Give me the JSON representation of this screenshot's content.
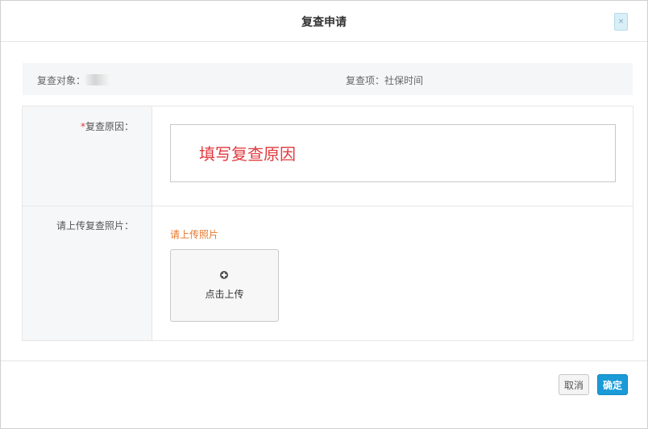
{
  "dialog": {
    "title": "复查申请",
    "close_label": "×"
  },
  "info": {
    "target_label": "复查对象：",
    "target_value_partial": "",
    "item_label": "复查项：社保时间"
  },
  "form": {
    "reason_required_mark": "*",
    "reason_label": "复查原因：",
    "reason_value": "填写复查原因",
    "upload_label": "请上传复查照片：",
    "upload_hint": "请上传照片",
    "upload_button_label": "点击上传"
  },
  "footer": {
    "cancel_label": "取消",
    "confirm_label": "确定"
  },
  "colors": {
    "accent": "#1a9bd8",
    "required": "#e0393e",
    "hint": "#e8772a"
  }
}
